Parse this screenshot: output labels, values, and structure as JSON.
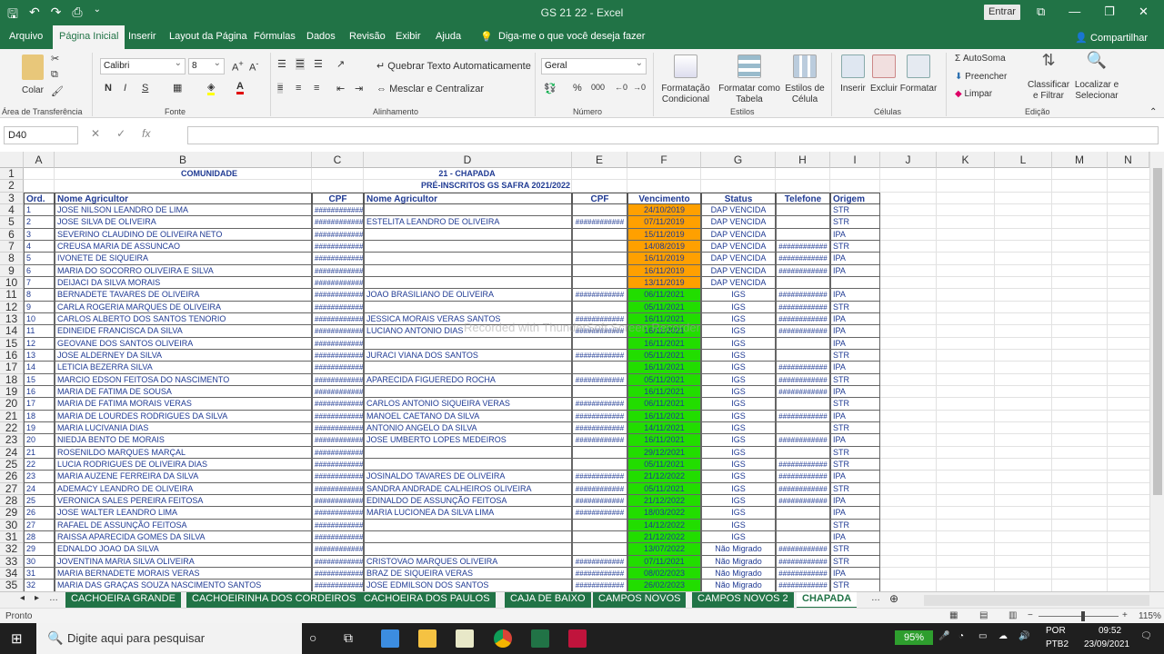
{
  "titlebar": {
    "title": "GS 21 22  -  Excel",
    "login": "Entrar"
  },
  "menu": {
    "tabs": [
      "Arquivo",
      "Página Inicial",
      "Inserir",
      "Layout da Página",
      "Fórmulas",
      "Dados",
      "Revisão",
      "Exibir",
      "Ajuda"
    ],
    "tell_me": "Diga-me o que você deseja fazer",
    "share": "Compartilhar"
  },
  "ribbon": {
    "paste": "Colar",
    "font_name": "Calibri",
    "font_size": "8",
    "wrap_text": "Quebrar Texto Automaticamente",
    "merge_center": "Mesclar e Centralizar",
    "number_format": "Geral",
    "cond_format": "Formatação Condicional",
    "format_table": "Formatar como Tabela",
    "cell_styles": "Estilos de Célula",
    "insert": "Inserir",
    "delete": "Excluir",
    "format": "Formatar",
    "autosum": "AutoSoma",
    "fill": "Preencher",
    "clear": "Limpar",
    "sort_filter": "Classificar e Filtrar",
    "find_select": "Localizar e Selecionar",
    "groups": {
      "clipboard": "Área de Transferência",
      "font": "Fonte",
      "alignment": "Alinhamento",
      "number": "Número",
      "styles": "Estilos",
      "cells": "Células",
      "editing": "Edição"
    }
  },
  "formula_bar": {
    "name_box": "D40",
    "formula": ""
  },
  "columns": [
    "A",
    "B",
    "C",
    "D",
    "E",
    "F",
    "G",
    "H",
    "I",
    "J",
    "K",
    "L",
    "M",
    "N"
  ],
  "sheet": {
    "title_community": "COMUNIDADE",
    "title_name": "21 - CHAPADA",
    "subtitle": "PRÉ-INSCRITOS GS SAFRA 2021/2022",
    "headers": [
      "Ord.",
      "Nome Agricultor",
      "CPF",
      "Nome Agricultor",
      "CPF",
      "Vencimento",
      "Status",
      "Telefone",
      "Origem"
    ],
    "rows": [
      [
        "1",
        "JOSE NILSON LEANDRO DE LIMA",
        "############",
        "",
        "",
        "24/10/2019",
        "DAP VENCIDA",
        "",
        "STR"
      ],
      [
        "2",
        "JOSE SILVA DE OLIVEIRA",
        "############",
        "ESTELITA LEANDRO DE OLIVEIRA",
        "############",
        "07/11/2019",
        "DAP VENCIDA",
        "",
        "STR"
      ],
      [
        "3",
        "SEVERINO CLAUDINO DE OLIVEIRA NETO",
        "############",
        "",
        "",
        "15/11/2019",
        "DAP VENCIDA",
        "",
        "IPA"
      ],
      [
        "4",
        "CREUSA MARIA DE ASSUNCAO",
        "############",
        "",
        "",
        "14/08/2019",
        "DAP VENCIDA",
        "############",
        "STR"
      ],
      [
        "5",
        "IVONETE DE SIQUEIRA",
        "############",
        "",
        "",
        "16/11/2019",
        "DAP VENCIDA",
        "############",
        "IPA"
      ],
      [
        "6",
        "MARIA DO SOCORRO OLIVEIRA E SILVA",
        "############",
        "",
        "",
        "16/11/2019",
        "DAP VENCIDA",
        "############",
        "IPA"
      ],
      [
        "7",
        "DEIJACI DA SILVA MORAIS",
        "############",
        "",
        "",
        "13/11/2019",
        "DAP VENCIDA",
        "",
        ""
      ],
      [
        "8",
        "BERNADETE TAVARES DE OLIVEIRA",
        "############",
        "JOAO BRASILIANO DE OLIVEIRA",
        "############",
        "06/11/2021",
        "IGS",
        "############",
        "IPA"
      ],
      [
        "9",
        "CARLA ROGERIA MARQUES DE OLIVEIRA",
        "############",
        "",
        "",
        "05/11/2021",
        "IGS",
        "############",
        "STR"
      ],
      [
        "10",
        "CARLOS ALBERTO DOS SANTOS TENORIO",
        "############",
        "JESSICA MORAIS VERAS SANTOS",
        "############",
        "16/11/2021",
        "IGS",
        "############",
        "IPA"
      ],
      [
        "11",
        "EDINEIDE FRANCISCA DA SILVA",
        "############",
        "LUCIANO ANTONIO DIAS",
        "############",
        "16/11/2021",
        "IGS",
        "############",
        "IPA"
      ],
      [
        "12",
        "GEOVANE DOS SANTOS OLIVEIRA",
        "############",
        "",
        "",
        "16/11/2021",
        "IGS",
        "",
        "IPA"
      ],
      [
        "13",
        "JOSE ALDERNEY DA SILVA",
        "############",
        "JURACI VIANA DOS SANTOS",
        "############",
        "05/11/2021",
        "IGS",
        "",
        "STR"
      ],
      [
        "14",
        "LETICIA BEZERRA SILVA",
        "############",
        "",
        "",
        "16/11/2021",
        "IGS",
        "############",
        "IPA"
      ],
      [
        "15",
        "MARCIO EDSON FEITOSA DO NASCIMENTO",
        "############",
        "APARECIDA FIGUEREDO ROCHA",
        "############",
        "05/11/2021",
        "IGS",
        "############",
        "STR"
      ],
      [
        "16",
        "MARIA DE FATIMA DE SOUSA",
        "############",
        "",
        "",
        "16/11/2021",
        "IGS",
        "############",
        "IPA"
      ],
      [
        "17",
        "MARIA DE FATIMA MORAIS VERAS",
        "############",
        "CARLOS ANTONIO SIQUEIRA VERAS",
        "############",
        "06/11/2021",
        "IGS",
        "",
        "STR"
      ],
      [
        "18",
        "MARIA DE LOURDES RODRIGUES DA SILVA",
        "############",
        "MANOEL CAETANO DA SILVA",
        "############",
        "16/11/2021",
        "IGS",
        "############",
        "IPA"
      ],
      [
        "19",
        "MARIA LUCIVANIA DIAS",
        "############",
        "ANTONIO ANGELO DA SILVA",
        "############",
        "14/11/2021",
        "IGS",
        "",
        "STR"
      ],
      [
        "20",
        "NIEDJA BENTO DE MORAIS",
        "############",
        "JOSE UMBERTO LOPES MEDEIROS",
        "############",
        "16/11/2021",
        "IGS",
        "############",
        "IPA"
      ],
      [
        "21",
        "ROSENILDO MARQUES MARÇAL",
        "############",
        "",
        "",
        "29/12/2021",
        "IGS",
        "",
        "STR"
      ],
      [
        "22",
        "LUCIA RODRIGUES DE OLIVEIRA DIAS",
        "############",
        "",
        "",
        "05/11/2021",
        "IGS",
        "############",
        "STR"
      ],
      [
        "23",
        "MARIA AUZENE FERREIRA DA SILVA",
        "############",
        "JOSINALDO TAVARES DE OLIVEIRA",
        "############",
        "21/12/2022",
        "IGS",
        "############",
        "IPA"
      ],
      [
        "24",
        "ADEMACY LEANDRO DE OLIVEIRA",
        "############",
        "SANDRA ANDRADE CALHEIROS OLIVEIRA",
        "############",
        "05/11/2021",
        "IGS",
        "############",
        "STR"
      ],
      [
        "25",
        "VERONICA SALES PEREIRA FEITOSA",
        "############",
        "EDINALDO DE ASSUNÇÃO FEITOSA",
        "############",
        "21/12/2022",
        "IGS",
        "############",
        "IPA"
      ],
      [
        "26",
        "JOSE WALTER LEANDRO LIMA",
        "############",
        "MARIA LUCIONEA DA SILVA LIMA",
        "############",
        "18/03/2022",
        "IGS",
        "",
        "IPA"
      ],
      [
        "27",
        "RAFAEL DE ASSUNÇÃO FEITOSA",
        "############",
        "",
        "",
        "14/12/2022",
        "IGS",
        "",
        "STR"
      ],
      [
        "28",
        "RAISSA APARECIDA GOMES DA SILVA",
        "############",
        "",
        "",
        "21/12/2022",
        "IGS",
        "",
        "IPA"
      ],
      [
        "29",
        "EDNALDO JOAO DA SILVA",
        "############",
        "",
        "",
        "13/07/2022",
        "Não Migrado",
        "############",
        "STR"
      ],
      [
        "30",
        "JOVENTINA MARIA SILVA OLIVEIRA",
        "############",
        "CRISTOVAO MARQUES OLIVEIRA",
        "############",
        "07/11/2021",
        "Não Migrado",
        "############",
        "STR"
      ],
      [
        "31",
        "MARIA BERNADETE MORAIS VERAS",
        "############",
        "BRAZ DE SIQUEIRA VERAS",
        "############",
        "08/02/2023",
        "Não Migrado",
        "############",
        "IPA"
      ],
      [
        "32",
        "MARIA DAS GRAÇAS SOUZA NASCIMENTO SANTOS",
        "############",
        "JOSE EDMILSON DOS SANTOS",
        "############",
        "26/02/2023",
        "Não Migrado",
        "############",
        "STR"
      ]
    ]
  },
  "colors": {
    "expired": "#ffa000",
    "valid": "#22dd00",
    "excel_green": "#217346"
  },
  "watermark": "Recorded with ThunderSoft Screen Recorder",
  "sheet_tabs": [
    "CACHOEIRA GRANDE",
    "CACHOEIRINHA DOS CORDEIROS",
    "CACHOEIRA DOS PAULOS",
    "CAJA DE BAIXO",
    "CAMPOS NOVOS",
    "CAMPOS NOVOS 2",
    "CHAPADA"
  ],
  "active_sheet": "CHAPADA",
  "status": {
    "ready": "Pronto",
    "zoom": "115%"
  },
  "taskbar": {
    "search": "Digite aqui para pesquisar",
    "battery": "95%",
    "lang": "POR",
    "layout": "PTB2",
    "time": "09:52",
    "date": "23/09/2021"
  }
}
